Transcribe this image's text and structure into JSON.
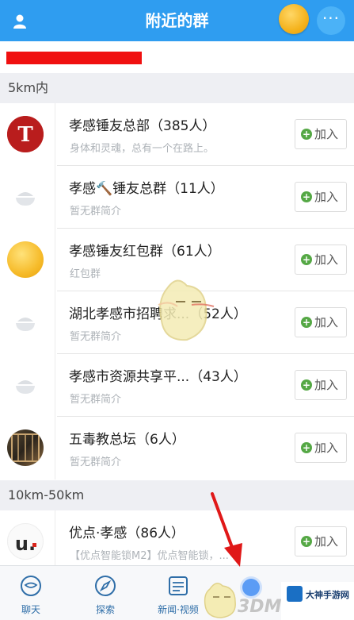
{
  "header": {
    "title": "附近的群",
    "more_label": "···"
  },
  "sections": [
    {
      "label": "5km内"
    },
    {
      "label": "10km-50km"
    }
  ],
  "groups": [
    {
      "name": "孝感锤友总部（385人）",
      "desc": "身体和灵魂，总有一个在路上。",
      "join_label": "加入",
      "avatar_text": "T"
    },
    {
      "name": "孝感🔨锤友总群（11人）",
      "desc": "暂无群简介",
      "join_label": "加入"
    },
    {
      "name": "孝感锤友红包群（61人）",
      "desc": "红包群",
      "join_label": "加入"
    },
    {
      "name": "湖北孝感市招聘求...（52人）",
      "desc": "暂无群简介",
      "join_label": "加入"
    },
    {
      "name": "孝感市资源共享平...（43人）",
      "desc": "暂无群简介",
      "join_label": "加入"
    },
    {
      "name": "五毒教总坛（6人）",
      "desc": "暂无群简介",
      "join_label": "加入"
    },
    {
      "name": "优点·孝感（86人）",
      "desc": "【优点智能锁M2】优点智能锁，...",
      "join_label": "加入",
      "avatar_text": "u."
    }
  ],
  "tabs": [
    {
      "label": "聊天"
    },
    {
      "label": "探索"
    },
    {
      "label": "新闻·视频"
    }
  ],
  "watermarks": {
    "logo_3dm": "3DM",
    "dashen": "大神手游网"
  },
  "colors": {
    "header_bg": "#2f9df0",
    "redact": "#f01010",
    "join_plus": "#55a845"
  }
}
